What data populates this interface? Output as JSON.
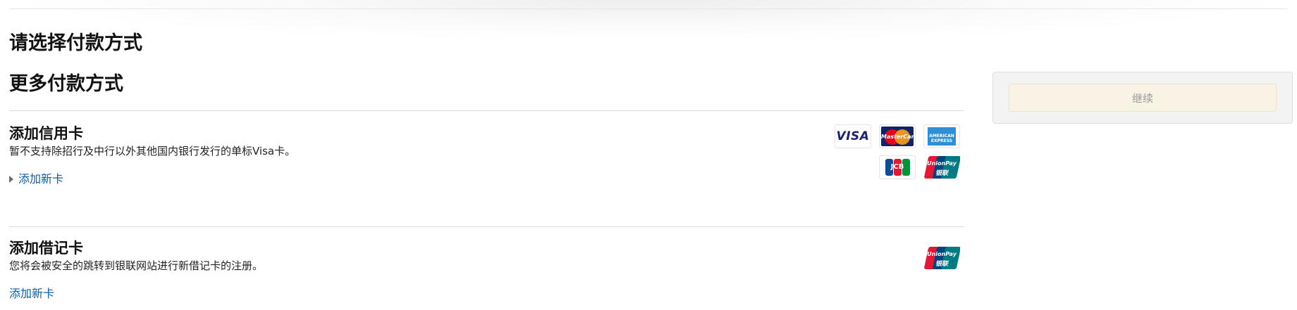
{
  "page": {
    "title": "请选择付款方式",
    "section_title": "更多付款方式"
  },
  "credit_card": {
    "title": "添加信用卡",
    "description": "暂不支持除招行及中行以外其他国内银行发行的单标Visa卡。",
    "add_link": "添加新卡",
    "logos": [
      {
        "name": "visa-logo",
        "label": "VISA",
        "color": "#1a1f71"
      },
      {
        "name": "mastercard-logo",
        "label": "MasterCard",
        "color": "#10236b"
      },
      {
        "name": "amex-logo",
        "label": "AMERICAN EXPRESS",
        "color": "#2f8fd5"
      },
      {
        "name": "jcb-logo",
        "label": "JCB",
        "color": "#0e4c96"
      },
      {
        "name": "unionpay-logo",
        "label": "UnionPay",
        "sub_label": "银联",
        "color": "#e21836"
      }
    ]
  },
  "debit_card": {
    "title": "添加借记卡",
    "description": "您将会被安全的跳转到银联网站进行新借记卡的注册。",
    "add_link": "添加新卡",
    "logos": [
      {
        "name": "unionpay-logo",
        "label": "UnionPay",
        "sub_label": "银联",
        "color": "#e21836"
      }
    ]
  },
  "sidebar": {
    "continue_label": "继续",
    "continue_enabled": false
  },
  "colors": {
    "link": "#0e5ea8",
    "button_bg": "#f9f3e6",
    "button_text": "#9a9a9a",
    "panel_bg": "#f3f3f3"
  }
}
